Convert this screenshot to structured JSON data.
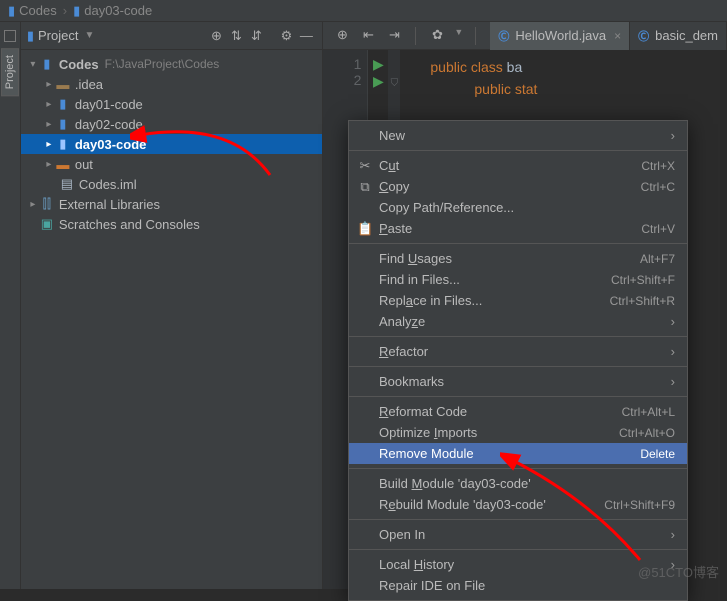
{
  "breadcrumb": {
    "root": "Codes",
    "current": "day03-code"
  },
  "sideTab": {
    "label": "Project"
  },
  "projectHeader": {
    "title": "Project"
  },
  "tree": {
    "root": {
      "label": "Codes",
      "path": "F:\\JavaProject\\Codes"
    },
    "idea": ".idea",
    "d1": "day01-code",
    "d2": "day02-code",
    "d3": "day03-code",
    "out": "out",
    "iml": "Codes.iml",
    "ext": "External Libraries",
    "scr": "Scratches and Consoles"
  },
  "tabs": {
    "t1": "HelloWorld.java",
    "t2": "basic_dem"
  },
  "code": {
    "l1a": "public",
    "l1b": "class",
    "l1c": "ba",
    "l2a": "public",
    "l2b": "stat"
  },
  "menu": {
    "new": "New",
    "cut": "Cut",
    "cut_sc": "Ctrl+X",
    "copy": "Copy",
    "copy_sc": "Ctrl+C",
    "copyPath": "Copy Path/Reference...",
    "paste": "Paste",
    "paste_sc": "Ctrl+V",
    "findUsages": "Find Usages",
    "findUsages_sc": "Alt+F7",
    "findInFiles": "Find in Files...",
    "findInFiles_sc": "Ctrl+Shift+F",
    "replaceInFiles": "Replace in Files...",
    "replaceInFiles_sc": "Ctrl+Shift+R",
    "analyze": "Analyze",
    "refactor": "Refactor",
    "bookmarks": "Bookmarks",
    "reformat": "Reformat Code",
    "reformat_sc": "Ctrl+Alt+L",
    "optimize": "Optimize Imports",
    "optimize_sc": "Ctrl+Alt+O",
    "remove": "Remove Module",
    "remove_sc": "Delete",
    "build": "Build Module 'day03-code'",
    "rebuild": "Rebuild Module 'day03-code'",
    "rebuild_sc": "Ctrl+Shift+F9",
    "openIn": "Open In",
    "localHist": "Local History",
    "repairIDE": "Repair IDE on File"
  },
  "watermark": "@51CTO博客"
}
